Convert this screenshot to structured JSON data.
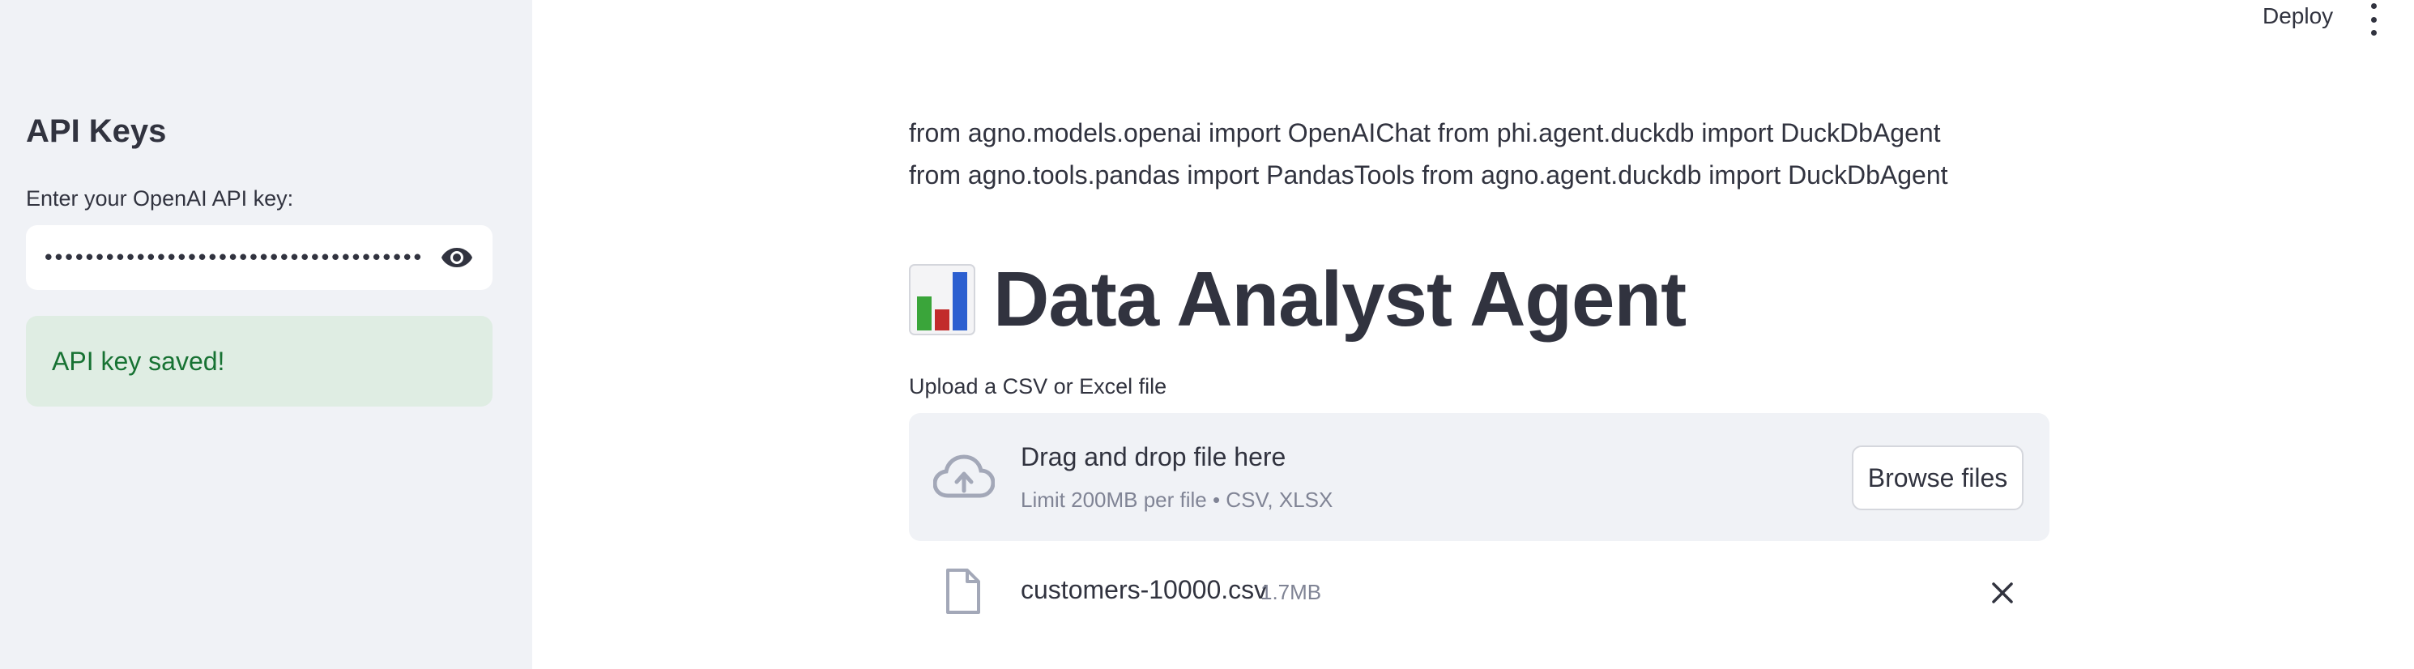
{
  "header": {
    "deploy_label": "Deploy",
    "menu_icon": "more-vertical-icon"
  },
  "sidebar": {
    "title": "API Keys",
    "api_key_label": "Enter your OpenAI API key:",
    "api_key_value": "••••••••••••••••••••••••••••••••••••••••••••••••••••",
    "visibility_icon": "eye-icon",
    "success_message": "API key saved!"
  },
  "main": {
    "import_text": "from agno.models.openai import OpenAIChat from phi.agent.duckdb import DuckDbAgent from agno.tools.pandas import PandasTools from agno.agent.duckdb import DuckDbAgent",
    "title_icon": "bar-chart-icon",
    "title": "Data Analyst Agent",
    "upload_label": "Upload a CSV or Excel file",
    "dropzone": {
      "icon": "cloud-upload-icon",
      "title": "Drag and drop file here",
      "subtitle": "Limit 200MB per file • CSV, XLSX",
      "browse_label": "Browse files"
    },
    "uploaded_file": {
      "icon": "file-icon",
      "name": "customers-10000.csv",
      "size": "1.7MB",
      "remove_icon": "close-icon"
    }
  },
  "colors": {
    "sidebar_bg": "#f0f2f6",
    "success_bg": "#dfede3",
    "success_text": "#177233",
    "text": "#31333f",
    "muted": "#808495"
  }
}
